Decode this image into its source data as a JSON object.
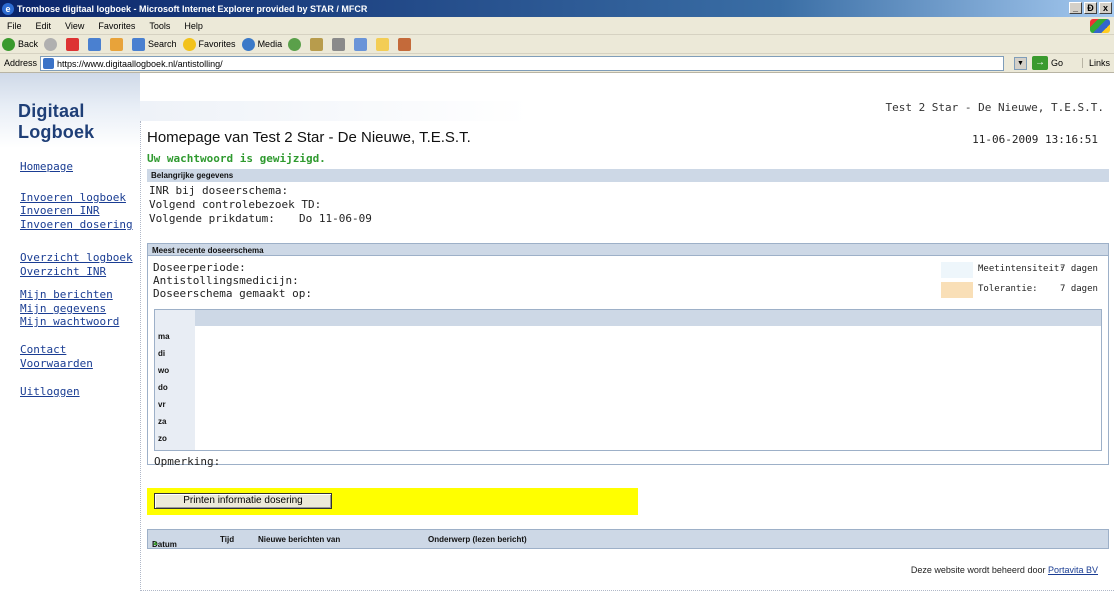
{
  "window": {
    "title": "Trombose digitaal logboek - Microsoft Internet Explorer provided by STAR / MFCR",
    "controls": [
      "_",
      "Ɖ",
      "x"
    ]
  },
  "menubar": [
    "File",
    "Edit",
    "View",
    "Favorites",
    "Tools",
    "Help"
  ],
  "toolbar": {
    "back": "Back",
    "search": "Search",
    "favorites": "Favorites",
    "media": "Media"
  },
  "addressbar": {
    "label": "Address",
    "url": "https://www.digitaallogboek.nl/antistolling/",
    "go": "Go",
    "links": "Links"
  },
  "site": {
    "logo": "Digitaal Logboek",
    "header_user": "Test 2 Star - De Nieuwe, T.E.S.T."
  },
  "nav": [
    "Homepage",
    "Invoeren logboek",
    "Invoeren INR",
    "Invoeren dosering",
    "Overzicht logboek",
    "Overzicht INR",
    "Mijn berichten",
    "Mijn gegevens",
    "Mijn wachtwoord",
    "Contact",
    "Voorwaarden",
    "Uitloggen"
  ],
  "main": {
    "title": "Homepage van Test 2 Star - De Nieuwe, T.E.S.T.",
    "timestamp": "11-06-2009 13:16:51",
    "confirmation": "Uw wachtwoord is gewijzigd."
  },
  "important": {
    "heading": "Belangrijke gegevens",
    "inr_label": "INR bij doseerschema:",
    "control_label": "Volgend controlebezoek TD:",
    "prick_label": "Volgende prikdatum:",
    "prick_value": "Do 11-06-09"
  },
  "schema": {
    "heading": "Meest recente doseerschema",
    "period_label": "Doseerperiode:",
    "medicine_label": "Antistollingsmedicijn:",
    "made_label": "Doseerschema gemaakt op:",
    "meet_label": "Meetintensiteit:",
    "meet_value": "7 dagen",
    "tol_label": "Tolerantie:",
    "tol_value": "7 dagen",
    "days": [
      "ma",
      "di",
      "wo",
      "do",
      "vr",
      "za",
      "zo"
    ],
    "remark_label": "Opmerking:",
    "colors": {
      "meet": "#eef6fb",
      "tolerance": "#f9dfb7"
    }
  },
  "print_button": "Printen informatie dosering",
  "messages": {
    "columns": [
      "Datum",
      "Tijd",
      "Nieuwe berichten van",
      "Onderwerp (lezen bericht)"
    ],
    "sort_indicator": "▲"
  },
  "footer": {
    "text": "Deze website wordt beheerd door",
    "link": "Portavita BV"
  }
}
